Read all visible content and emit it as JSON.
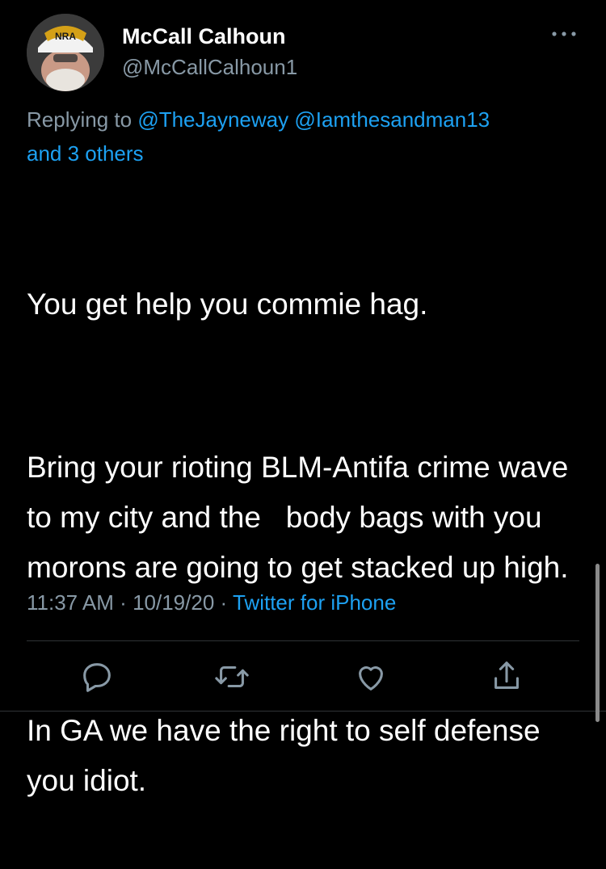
{
  "author": {
    "name": "McCall Calhoun",
    "handle": "@McCallCalhoun1",
    "avatar_badge": "NRA"
  },
  "reply": {
    "prefix": "Replying to",
    "mentions": [
      "@TheJayneway",
      "@Iamthesandman13"
    ],
    "others": "and 3 others"
  },
  "tweet": {
    "paragraphs": [
      "You get help you commie hag.",
      "Bring your rioting BLM-Antifa crime wave to my city and the   body bags with you morons are going to get stacked up high.",
      "In GA we have the right to self defense you idiot."
    ]
  },
  "meta": {
    "time": "11:37 AM",
    "date": "10/19/20",
    "separator": "·",
    "source": "Twitter for iPhone"
  },
  "actions": [
    "reply-icon",
    "retweet-icon",
    "like-icon",
    "share-icon"
  ],
  "colors": {
    "background": "#000000",
    "text": "#ffffff",
    "secondary": "#8899a6",
    "link": "#1da1f2",
    "divider": "#2f3336"
  }
}
